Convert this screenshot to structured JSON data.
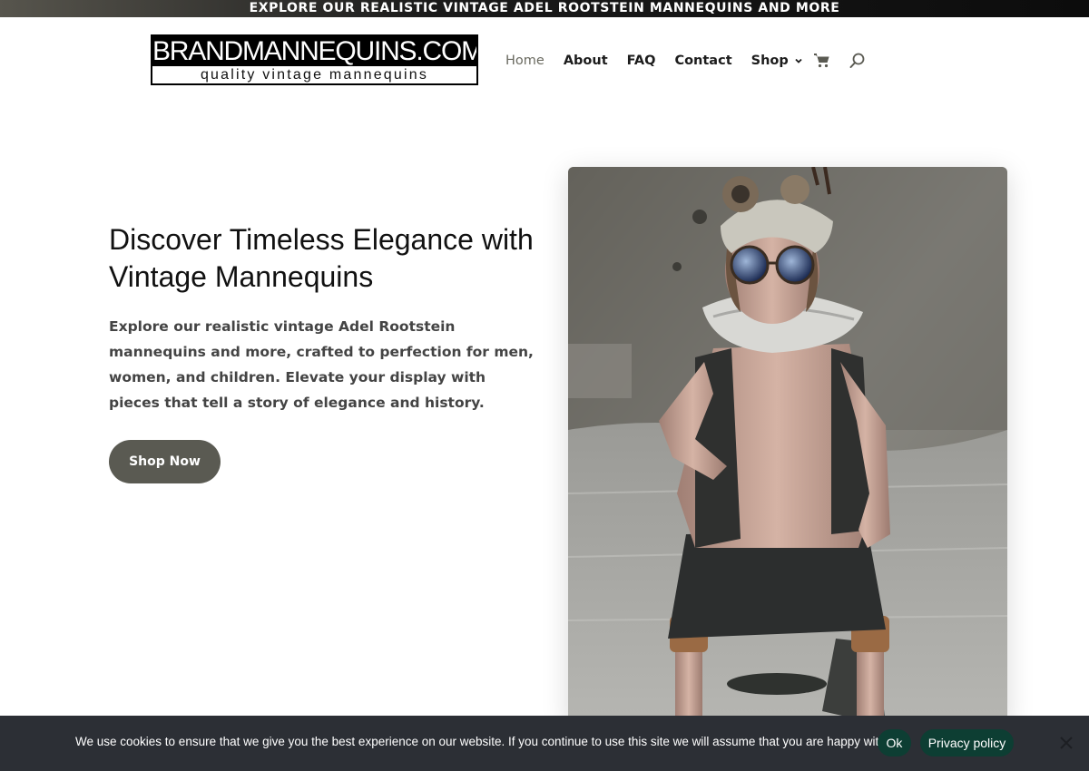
{
  "announcement": "EXPLORE OUR REALISTIC VINTAGE ADEL ROOTSTEIN MANNEQUINS AND MORE",
  "logo": {
    "top": "BRANDMANNEQUINS.COM",
    "bottom": "quality vintage mannequins"
  },
  "nav": {
    "items": [
      "Home",
      "About",
      "FAQ",
      "Contact",
      "Shop"
    ],
    "active": "Home",
    "icons": [
      "cart-icon",
      "search-icon"
    ]
  },
  "hero": {
    "title": "Discover Timeless Elegance with Vintage Mannequins",
    "text": "Explore our realistic vintage Adel Rootstein mannequins and more, crafted to perfection for men, women, and children. Elevate your display with pieces that tell a story of elegance and history.",
    "button": "Shop Now"
  },
  "cookie": {
    "text": "We use cookies to ensure that we give you the best experience on our website. If you continue to use this site we will assume that you are happy with it.",
    "ok": "Ok",
    "privacy": "Privacy policy"
  },
  "colors": {
    "button": "#5a5a52",
    "cookie_bg": "#2c2f35",
    "cookie_button": "#0d3e33",
    "nav_active": "#6a6a60"
  }
}
